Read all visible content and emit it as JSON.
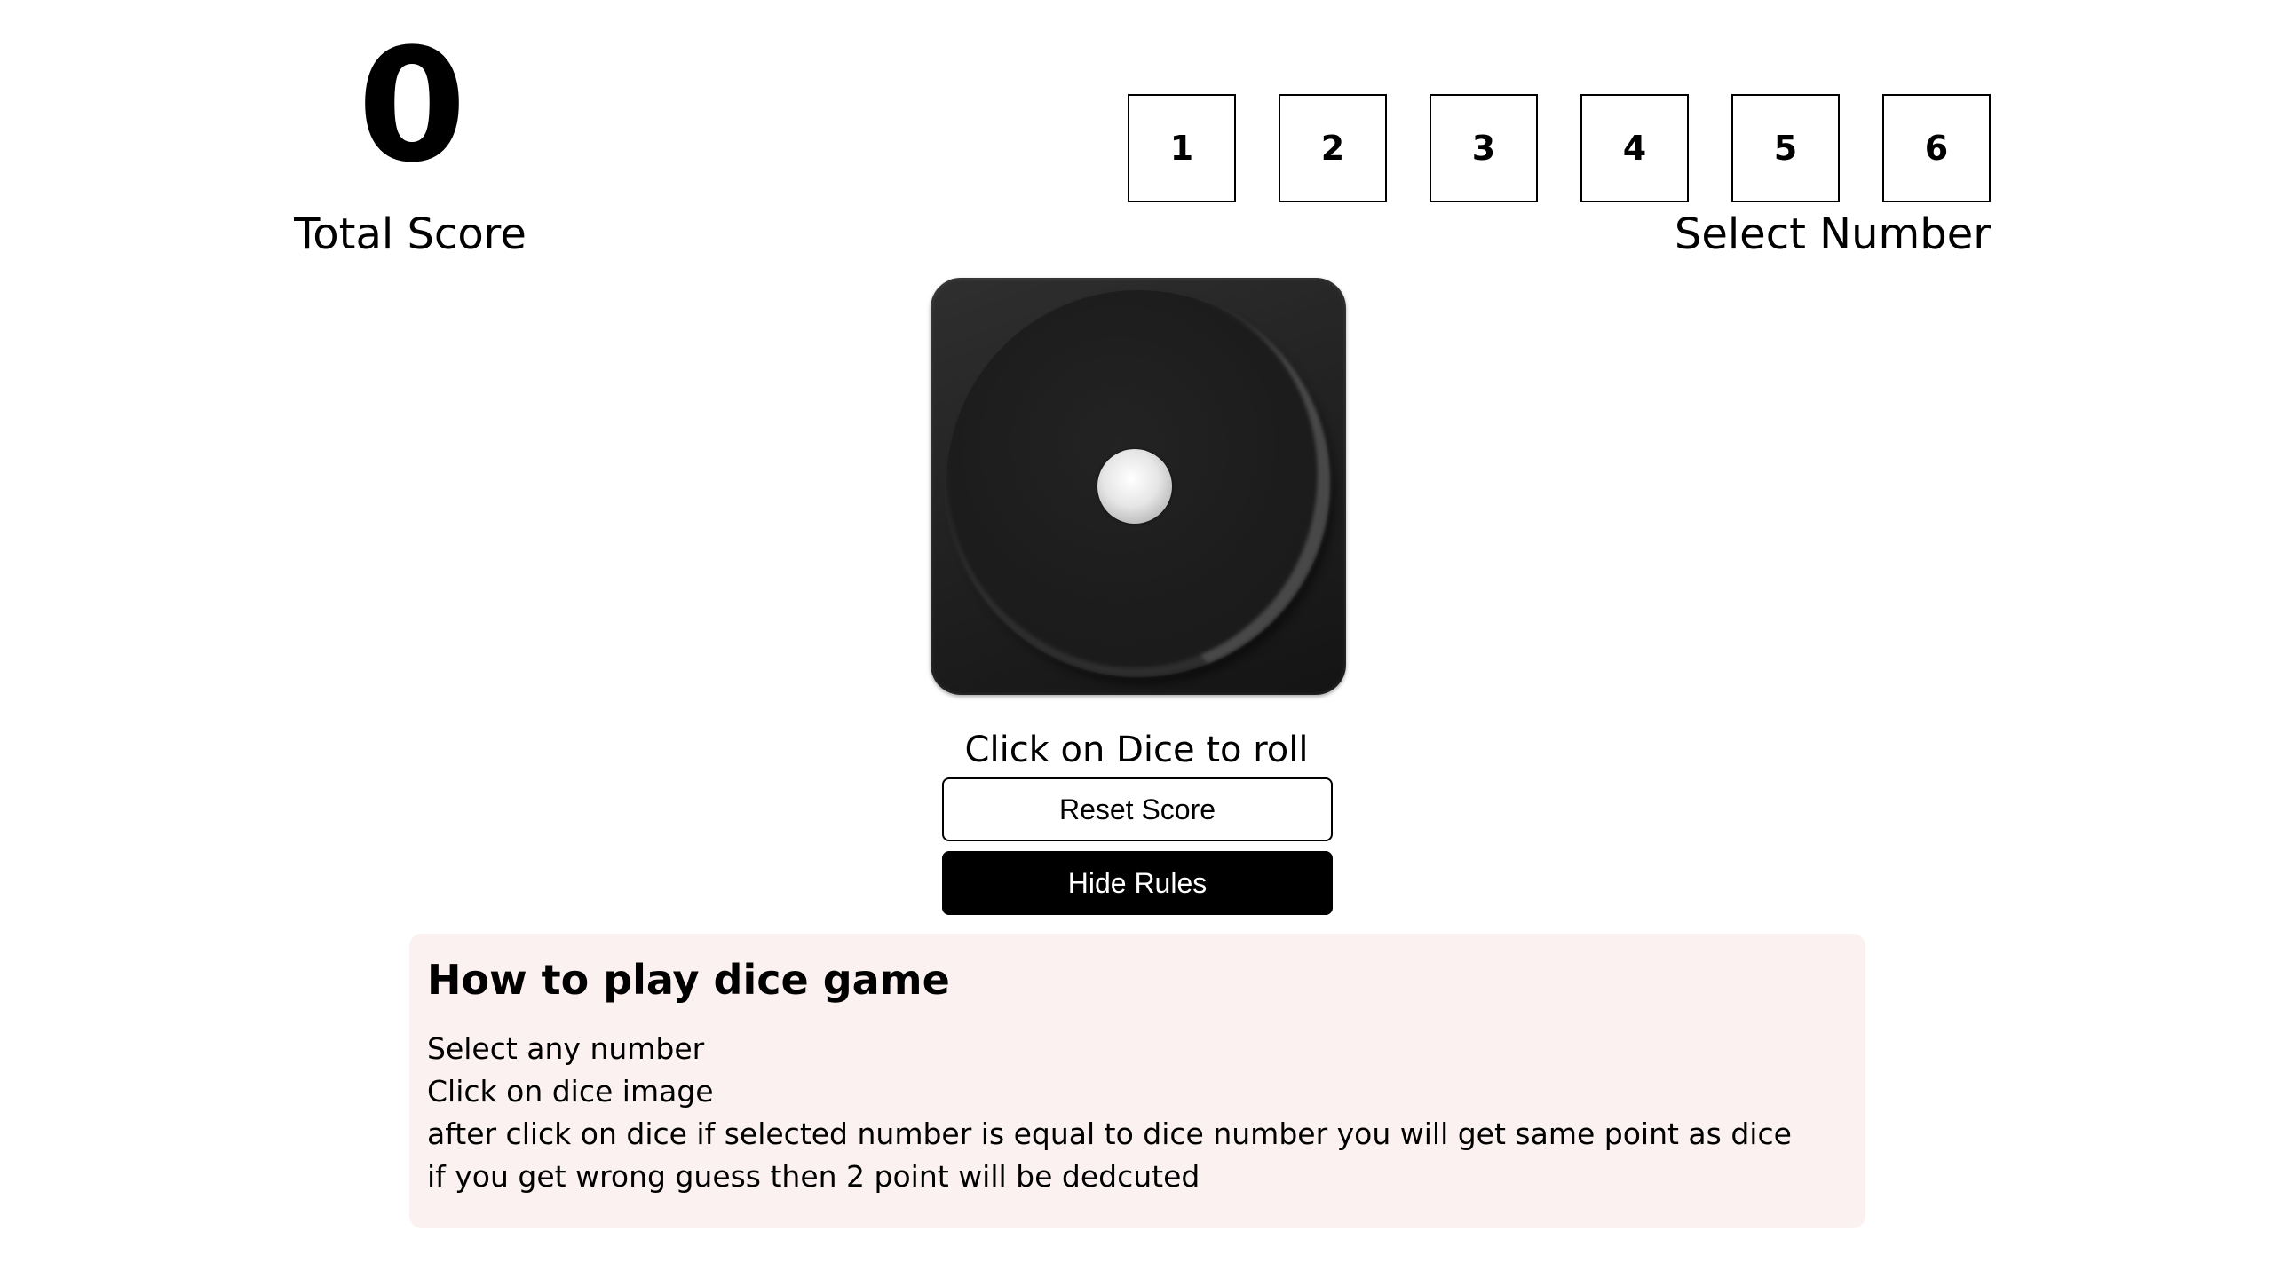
{
  "score": {
    "value": "0",
    "label": "Total Score"
  },
  "selector": {
    "numbers": [
      "1",
      "2",
      "3",
      "4",
      "5",
      "6"
    ],
    "label": "Select Number"
  },
  "dice": {
    "current_value": 1,
    "hint": "Click on Dice to roll"
  },
  "buttons": {
    "reset_label": "Reset Score",
    "rules_label": "Hide Rules"
  },
  "rules": {
    "title": "How to play dice game",
    "items": [
      "Select any number",
      "Click on dice image",
      "after click on dice if selected number is equal to dice number you will get same point as dice",
      "if you get wrong guess then 2 point will be dedcuted"
    ]
  },
  "colors": {
    "background": "#ffffff",
    "text": "#000000",
    "rules_panel": "#fbf1f1",
    "dice": "#1e1e1e",
    "button_dark": "#000000"
  }
}
